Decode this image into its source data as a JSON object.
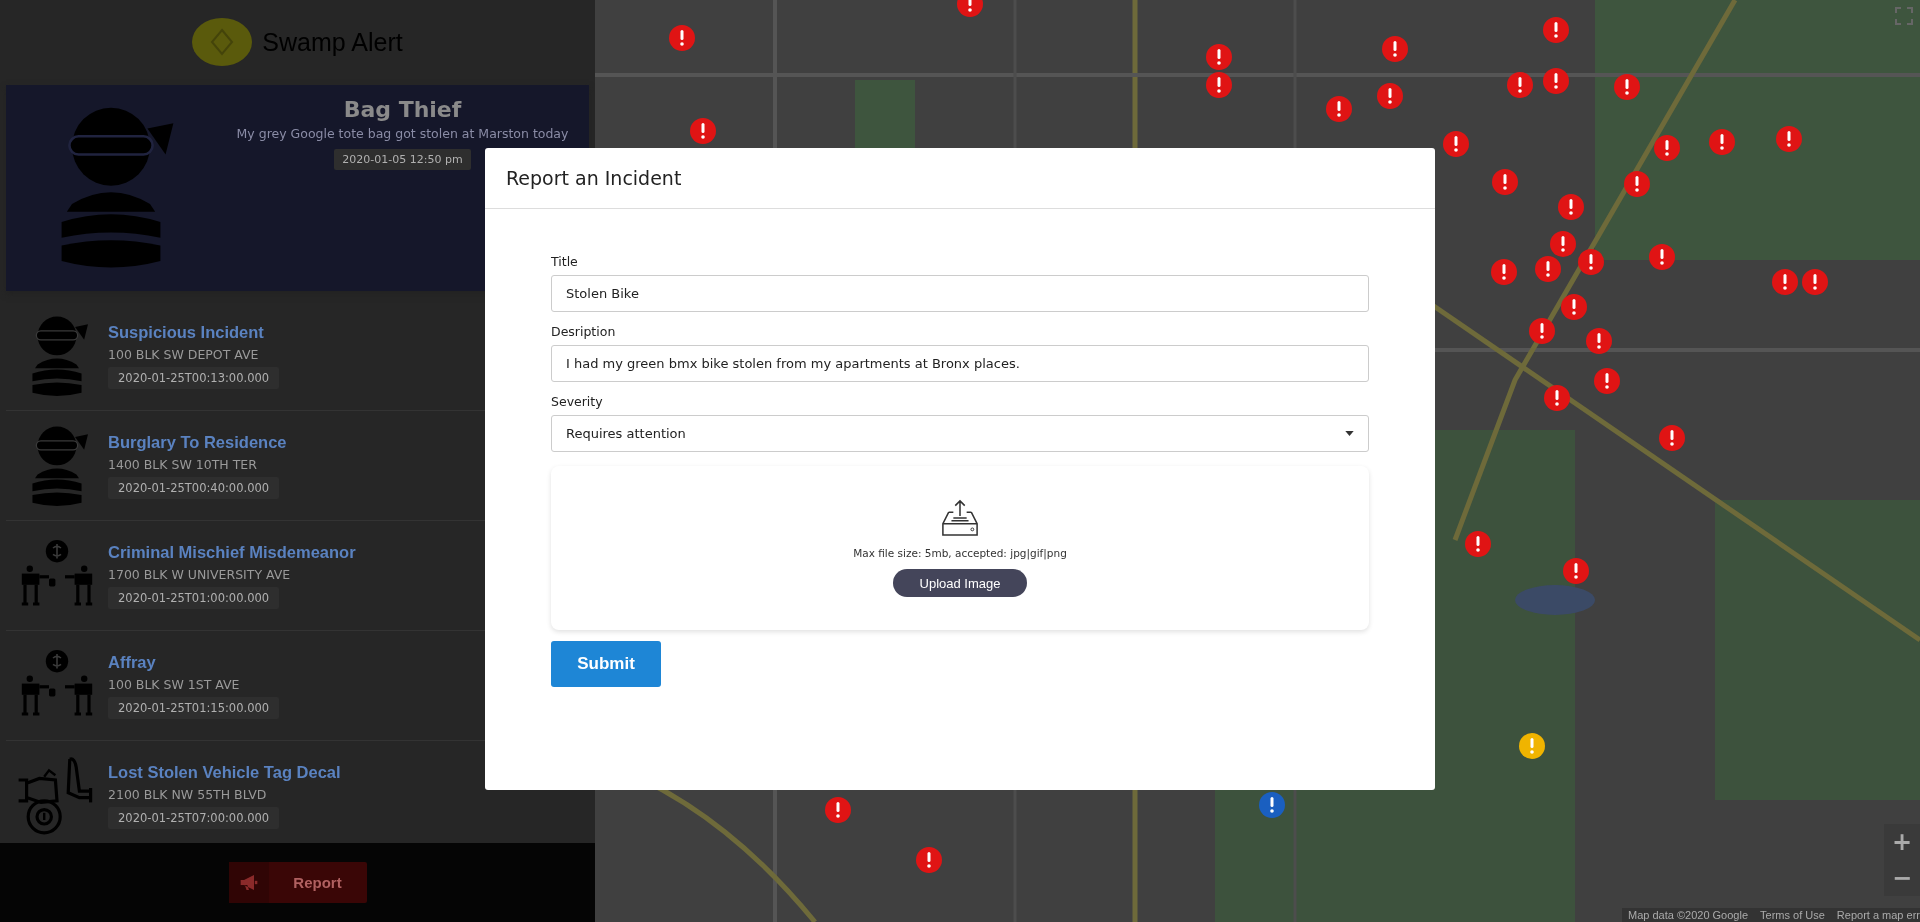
{
  "app": {
    "title": "Swamp Alert"
  },
  "featured": {
    "title": "Bag Thief",
    "description": "My grey Google tote bag got stolen at Marston today",
    "time": "2020-01-05 12:50 pm",
    "kind": "thief"
  },
  "incidents": [
    {
      "title": "Suspicious Incident",
      "address": "100 BLK SW DEPOT AVE",
      "time": "2020-01-25T00:13:00.000",
      "kind": "thief"
    },
    {
      "title": "Burglary To Residence",
      "address": "1400 BLK SW 10TH TER",
      "time": "2020-01-25T00:40:00.000",
      "kind": "thief"
    },
    {
      "title": "Criminal Mischief Misdemeanor",
      "address": "1700 BLK W UNIVERSITY AVE",
      "time": "2020-01-25T01:00:00.000",
      "kind": "money"
    },
    {
      "title": "Affray",
      "address": "100 BLK SW 1ST AVE",
      "time": "2020-01-25T01:15:00.000",
      "kind": "money"
    },
    {
      "title": "Lost Stolen Vehicle Tag Decal",
      "address": "2100 BLK NW 55TH BLVD",
      "time": "2020-01-25T07:00:00.000",
      "kind": "vehicle"
    }
  ],
  "report_button": {
    "label": "Report"
  },
  "map": {
    "markers": [
      {
        "color": "#e01414"
      },
      {
        "color": "#e01414"
      },
      {
        "color": "#e01414"
      },
      {
        "color": "#e01414"
      },
      {
        "color": "#e01414"
      },
      {
        "color": "#e01414"
      },
      {
        "color": "#e01414"
      },
      {
        "color": "#e01414"
      },
      {
        "color": "#e01414"
      },
      {
        "color": "#e01414"
      },
      {
        "color": "#e01414"
      },
      {
        "color": "#e01414"
      },
      {
        "color": "#e01414"
      },
      {
        "color": "#e01414"
      },
      {
        "color": "#e01414"
      },
      {
        "color": "#e01414"
      },
      {
        "color": "#e01414"
      },
      {
        "color": "#e01414"
      },
      {
        "color": "#e01414"
      },
      {
        "color": "#e01414"
      },
      {
        "color": "#e01414"
      },
      {
        "color": "#e01414"
      },
      {
        "color": "#e01414"
      },
      {
        "color": "#e01414"
      },
      {
        "color": "#e01414"
      },
      {
        "color": "#e01414"
      },
      {
        "color": "#e01414"
      },
      {
        "color": "#e01414"
      },
      {
        "color": "#e01414"
      },
      {
        "color": "#e01414"
      },
      {
        "color": "#e01414"
      },
      {
        "color": "#e01414"
      },
      {
        "color": "#e01414"
      },
      {
        "color": "#e01414"
      },
      {
        "color": "#f0b400"
      },
      {
        "color": "#1a5fc0"
      },
      {
        "color": "#e01414"
      },
      {
        "color": "#e01414"
      }
    ],
    "zoom_in": "+",
    "zoom_out": "−",
    "attribution": [
      "Map data ©2020 Google",
      "Terms of Use",
      "Report a map err"
    ]
  },
  "modal": {
    "title": "Report an Incident",
    "fields": [
      {
        "label": "Title",
        "value": "Stolen Bike",
        "kind": "text"
      },
      {
        "label": "Desription",
        "value": "I had my green bmx bike stolen from my apartments at Bronx places.",
        "kind": "text"
      },
      {
        "label": "Severity",
        "value": "Requires attention",
        "kind": "select"
      }
    ],
    "upload": {
      "hint": "Max file size: 5mb, accepted: jpg|gif|png",
      "button": "Upload Image"
    },
    "submit": "Submit"
  }
}
